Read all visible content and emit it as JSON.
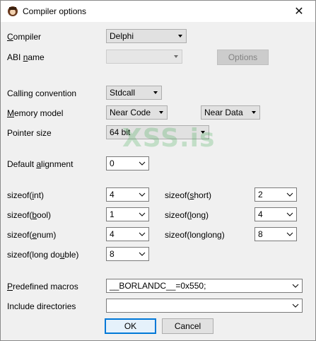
{
  "window": {
    "title": "Compiler options",
    "close_glyph": "✕"
  },
  "fields": {
    "compiler": {
      "label": "Compiler",
      "value": "Delphi"
    },
    "abi_name": {
      "label": "ABI name",
      "value": ""
    },
    "options_button": "Options",
    "calling_convention": {
      "label": "Calling convention",
      "value": "Stdcall"
    },
    "memory_model": {
      "label": "Memory model",
      "code_value": "Near Code",
      "data_value": "Near Data"
    },
    "pointer_size": {
      "label": "Pointer size",
      "value": "64 bit"
    },
    "default_alignment": {
      "label": "Default alignment",
      "value": "0"
    },
    "sizeof_int": {
      "label": "sizeof(int)",
      "value": "4"
    },
    "sizeof_short": {
      "label": "sizeof(short)",
      "value": "2"
    },
    "sizeof_bool": {
      "label": "sizeof(bool)",
      "value": "1"
    },
    "sizeof_long": {
      "label": "sizeof(long)",
      "value": "4"
    },
    "sizeof_enum": {
      "label": "sizeof(enum)",
      "value": "4"
    },
    "sizeof_longlong": {
      "label": "sizeof(longlong)",
      "value": "8"
    },
    "sizeof_long_double": {
      "label": "sizeof(long double)",
      "value": "8"
    },
    "predefined_macros": {
      "label": "Predefined macros",
      "value": "__BORLANDC__=0x550;"
    },
    "include_directories": {
      "label": "Include directories",
      "value": ""
    }
  },
  "buttons": {
    "ok": "OK",
    "cancel": "Cancel"
  },
  "watermark": "XSS.is",
  "colors": {
    "accent": "#0078d7",
    "dialog_bg": "#f0f0f0",
    "watermark": "#22a036"
  }
}
